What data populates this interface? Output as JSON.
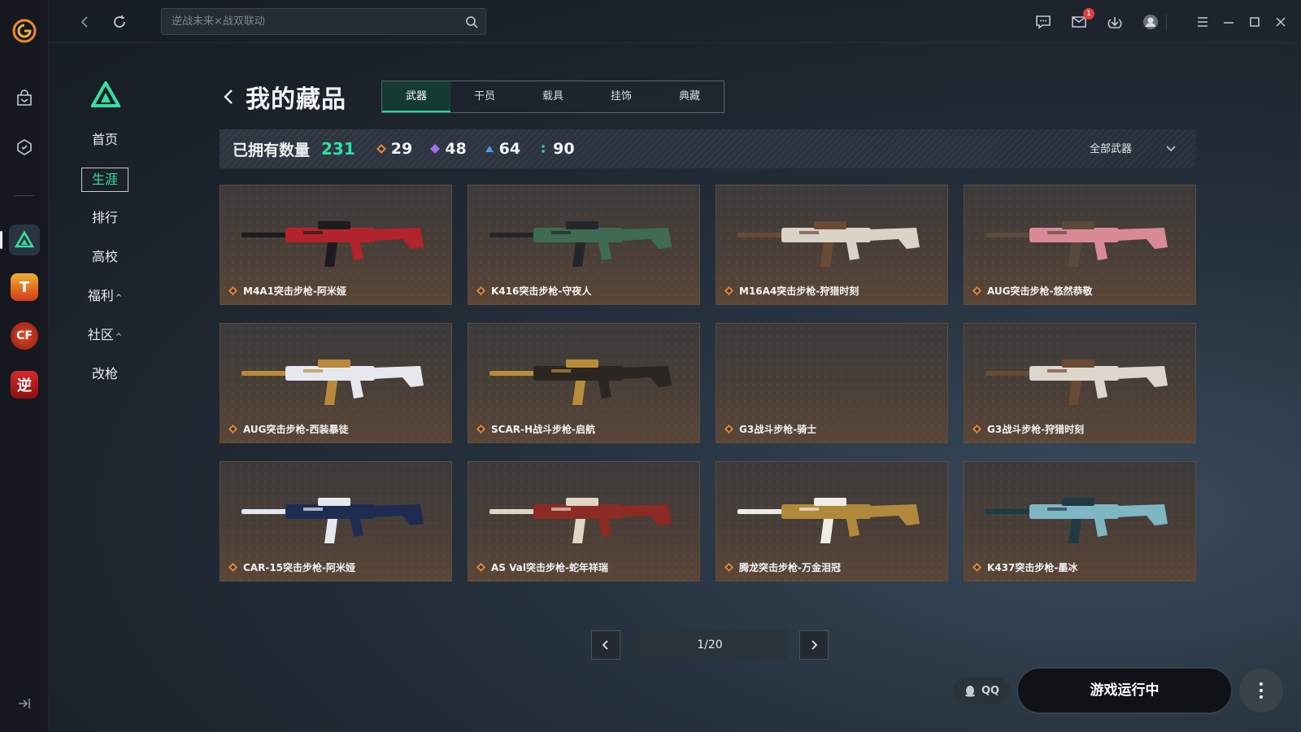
{
  "topbar": {
    "search_placeholder": "逆战未来×战双联动",
    "mail_badge": "1"
  },
  "subnav": {
    "items": [
      {
        "label": "首页",
        "caret": ""
      },
      {
        "label": "生涯",
        "caret": ""
      },
      {
        "label": "排行",
        "caret": ""
      },
      {
        "label": "高校",
        "caret": ""
      },
      {
        "label": "福利",
        "caret": "^"
      },
      {
        "label": "社区",
        "caret": "^"
      },
      {
        "label": "改枪",
        "caret": ""
      }
    ],
    "active": "生涯"
  },
  "page": {
    "title": "我的藏品",
    "tabs": [
      "武器",
      "干员",
      "载具",
      "挂饰",
      "典藏"
    ],
    "active_tab": "武器"
  },
  "stats": {
    "label": "已拥有数量",
    "total": "231",
    "rarities": [
      {
        "value": "29",
        "color": "#e0883a"
      },
      {
        "value": "48",
        "color": "#a56df0"
      },
      {
        "value": "64",
        "color": "#4a9ef0"
      },
      {
        "value": "90",
        "color": "#35d0a0"
      }
    ],
    "filter_label": "全部武器"
  },
  "items": [
    {
      "name": "M4A1突击步枪-阿米娅",
      "gun_color": "#b3232b",
      "accent": "#1c1c1f"
    },
    {
      "name": "K416突击步枪-守夜人",
      "gun_color": "#3e6b52",
      "accent": "#23272b"
    },
    {
      "name": "M16A4突击步枪-狩猎时刻",
      "gun_color": "#d9d3c8",
      "accent": "#6b4a33"
    },
    {
      "name": "AUG突击步枪-悠然恭敬",
      "gun_color": "#d98a96",
      "accent": "#5a4a3a"
    },
    {
      "name": "AUG突击步枪-西装暴徒",
      "gun_color": "#e6e8ee",
      "accent": "#b8893a"
    },
    {
      "name": "SCAR-H战斗步枪-启航",
      "gun_color": "#2a2622",
      "accent": "#b88d3a"
    },
    {
      "name": "G3战斗步枪-骑士",
      "gun_color": "",
      "accent": ""
    },
    {
      "name": "G3战斗步枪-狩猎时刻",
      "gun_color": "#dcd6cc",
      "accent": "#6b4a33"
    },
    {
      "name": "CAR-15突击步枪-阿米娅",
      "gun_color": "#1e2c52",
      "accent": "#e6e8ee"
    },
    {
      "name": "AS Val突击步枪-蛇年祥瑞",
      "gun_color": "#8c2a24",
      "accent": "#e0d6c4"
    },
    {
      "name": "腾龙突击步枪-万金泪冠",
      "gun_color": "#b08a3a",
      "accent": "#f0ece4"
    },
    {
      "name": "K437突击步枪-墨冰",
      "gun_color": "#7fb6c4",
      "accent": "#1f3a44"
    }
  ],
  "pager": {
    "label": "1/20"
  },
  "footer": {
    "qq_label": "QQ",
    "launch_label": "游戏运行中"
  }
}
